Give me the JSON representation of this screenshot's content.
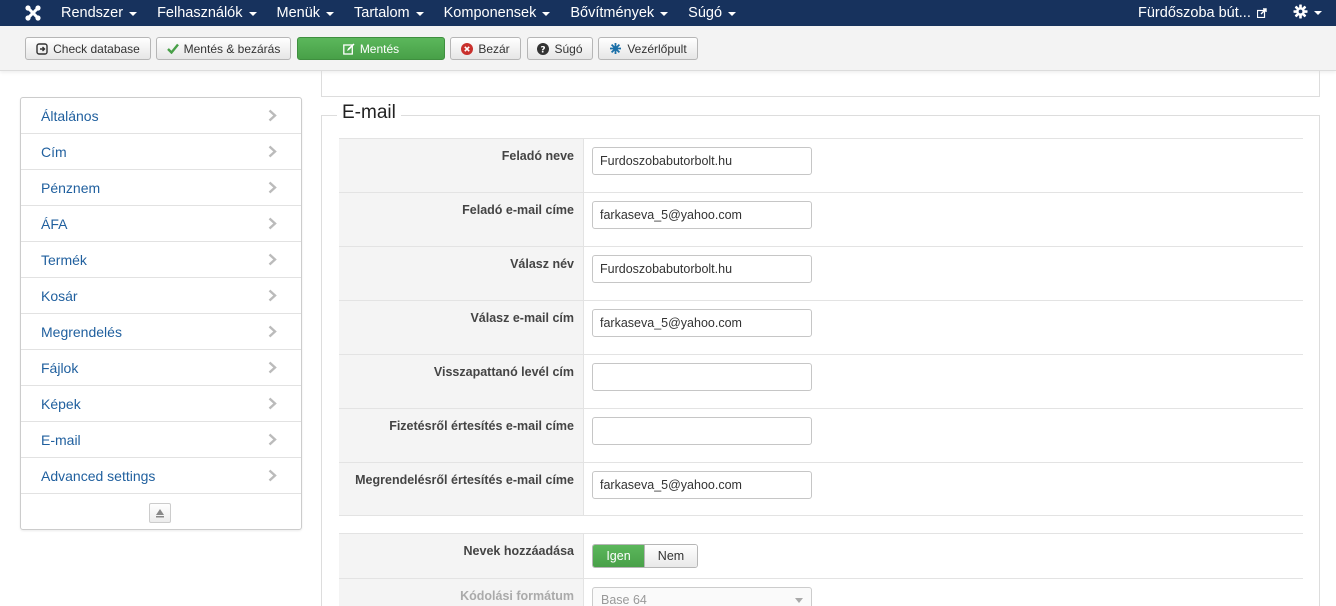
{
  "navbar": {
    "logo_icon": "joomla-logo-icon",
    "menu": [
      {
        "label": "Rendszer"
      },
      {
        "label": "Felhasználók"
      },
      {
        "label": "Menük"
      },
      {
        "label": "Tartalom"
      },
      {
        "label": "Komponensek"
      },
      {
        "label": "Bővítmények"
      },
      {
        "label": "Súgó"
      }
    ],
    "site_label": "Fürdőszoba bút...",
    "site_icon": "external-link-icon",
    "settings_icon": "gear-icon"
  },
  "toolbar": {
    "check_database": "Check database",
    "save_close": "Mentés & bezárás",
    "save": "Mentés",
    "close": "Bezár",
    "help": "Súgó",
    "dashboard": "Vezérlőpult"
  },
  "sidebar": {
    "items": [
      {
        "label": "Általános"
      },
      {
        "label": "Cím"
      },
      {
        "label": "Pénznem"
      },
      {
        "label": "ÁFA"
      },
      {
        "label": "Termék"
      },
      {
        "label": "Kosár"
      },
      {
        "label": "Megrendelés"
      },
      {
        "label": "Fájlok"
      },
      {
        "label": "Képek"
      },
      {
        "label": "E-mail"
      },
      {
        "label": "Advanced settings"
      }
    ],
    "collapse_icon": "collapse-up-icon"
  },
  "email": {
    "legend": "E-mail",
    "fields": [
      {
        "label": "Feladó neve",
        "value": "Furdoszobabutorbolt.hu"
      },
      {
        "label": "Feladó e-mail címe",
        "value": "farkaseva_5@yahoo.com"
      },
      {
        "label": "Válasz név",
        "value": "Furdoszobabutorbolt.hu"
      },
      {
        "label": "Válasz e-mail cím",
        "value": "farkaseva_5@yahoo.com"
      },
      {
        "label": "Visszapattanó levél cím",
        "value": ""
      },
      {
        "label": "Fizetésről értesítés e-mail címe",
        "value": ""
      },
      {
        "label": "Megrendelésről értesítés e-mail címe",
        "value": "farkaseva_5@yahoo.com"
      }
    ],
    "names_toggle": {
      "label": "Nevek hozzáadása",
      "on": "Igen",
      "off": "Nem",
      "selected": "Igen"
    },
    "encoding": {
      "label": "Kódolási formátum",
      "value": "Base 64"
    }
  },
  "colors": {
    "navbar": "#17325d",
    "accent_green": "#51a351",
    "link_blue": "#1f5f9e"
  }
}
